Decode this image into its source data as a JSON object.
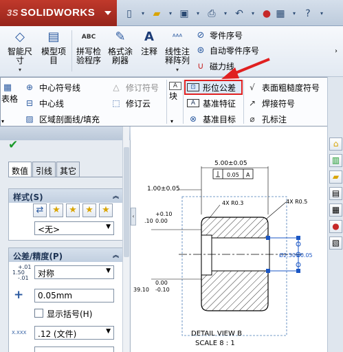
{
  "app": {
    "brand_prefix": "3S",
    "brand_name": "SOLIDWORKS"
  },
  "quick_access": {
    "icons": [
      "new-document-icon",
      "open-folder-icon",
      "save-icon",
      "print-icon",
      "undo-icon",
      "rebuild-traffic-light-icon",
      "help-icon"
    ]
  },
  "ribbon": {
    "smart_dimension": "智能尺寸",
    "model_items": "模型项目",
    "spell_check": "拼写检验程序",
    "format_painter": "格式涂刷器",
    "note": "注释",
    "linear_pattern": "线性注释阵列",
    "balloon": "零件序号",
    "auto_balloon": "自动零件序号",
    "magnetic_line": "磁力线",
    "abc_label": "ABC"
  },
  "annotation_panel": {
    "table": "表格",
    "center_mark": "中心符号线",
    "centerline": "中心线",
    "area_hatch": "区域剖面线/填充",
    "revision_symbol": "修订符号",
    "revision_cloud": "修订云",
    "block": "块",
    "gtol": "形位公差",
    "datum_feature": "基准特征",
    "datum_target": "基准目标",
    "surface_finish": "表面粗糙度符号",
    "weld_symbol": "焊接符号",
    "hole_callout": "孔标注"
  },
  "property_manager": {
    "tabs": [
      "数值",
      "引线",
      "其它"
    ],
    "style_group": {
      "title": "样式(S)",
      "style_select": "<无>"
    },
    "tolerance_group": {
      "title": "公差/精度(P)",
      "tol_icon_text": "1.50",
      "tol_icon_sup": "+.01",
      "tol_icon_sub": "-.01",
      "tolerance_type": "对称",
      "plus_value": "0.05mm",
      "show_parentheses": "显示括号(H)",
      "precision_icon": "X.XXX",
      "precision": ".12 (文件)"
    }
  },
  "drawing": {
    "top_dim": "5.00±0.05",
    "gtol_frame": [
      "0.05",
      "A"
    ],
    "left_dim_top": "1.00±0.05",
    "radius_1": "4X R0.3",
    "radius_2": "4X R0.5",
    "tol_plus_1": "+0.10",
    "tol_minus_1": "0.00",
    "nominal_1": ".10",
    "diameter_dim": "Ø2.50±0.05",
    "tol_plus_2": "0.00",
    "tol_minus_2": "-0.10",
    "nominal_2": "39.10",
    "datum_label": "A",
    "detail_title": "DETAIL VIEW B",
    "detail_scale": "SCALE 8 : 1"
  }
}
